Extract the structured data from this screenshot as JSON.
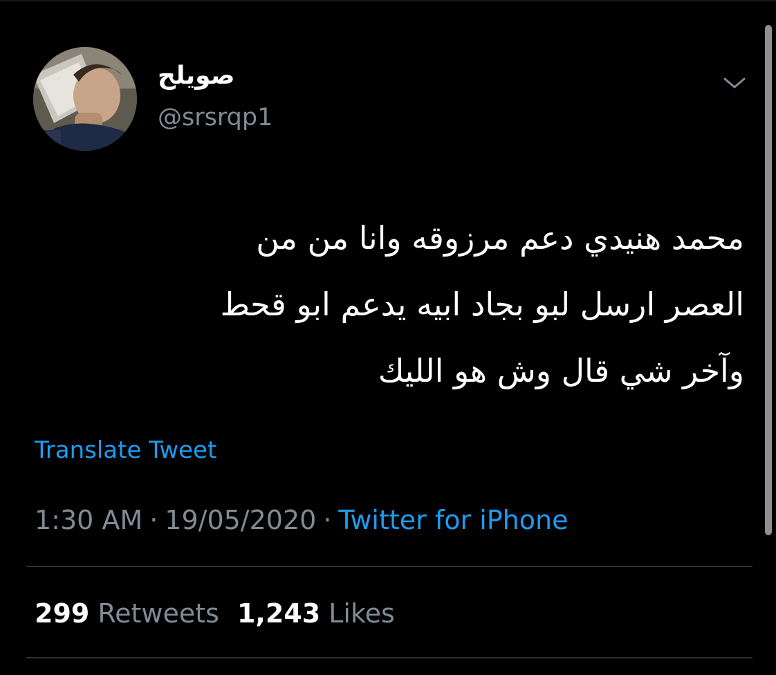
{
  "tweet": {
    "author": {
      "display_name": "صويلح",
      "handle": "@srsrqp1"
    },
    "text_lines": [
      "محمد هنيدي دعم مرزوقه وانا من من",
      "العصر ارسل لبو بجاد ابيه يدعم ابو قحط",
      "وآخر شي قال وش هو الليك"
    ],
    "translate_label": "Translate Tweet",
    "time": "1:30 AM",
    "separator": "·",
    "date": "19/05/2020",
    "source": "Twitter for iPhone",
    "retweets_count": "299",
    "retweets_label": "Retweets",
    "likes_count": "1,243",
    "likes_label": "Likes"
  },
  "icons": {
    "menu": "chevron-down-icon"
  },
  "colors": {
    "background": "#000000",
    "accent": "#1d9bf0",
    "secondary_text": "#808b95",
    "divider": "#2f3336"
  }
}
